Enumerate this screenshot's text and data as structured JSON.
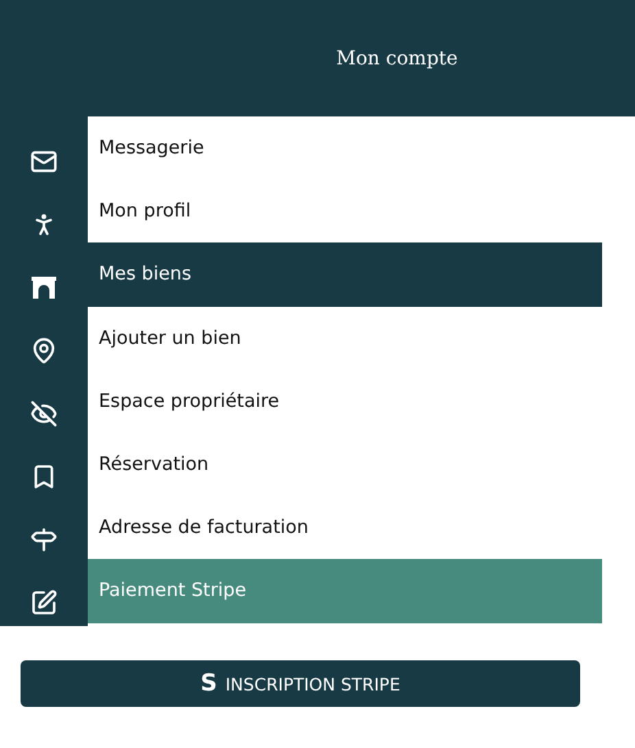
{
  "header": {
    "title": "Mon compte"
  },
  "menu": {
    "items": [
      {
        "label": "Messagerie",
        "selected": false,
        "highlighted": false
      },
      {
        "label": "Mon profil",
        "selected": false,
        "highlighted": false
      },
      {
        "label": "Mes biens",
        "selected": false,
        "highlighted": true
      },
      {
        "label": "Ajouter un bien",
        "selected": false,
        "highlighted": false
      },
      {
        "label": "Espace propriétaire",
        "selected": false,
        "highlighted": false
      },
      {
        "label": "Réservation",
        "selected": false,
        "highlighted": false
      },
      {
        "label": "Adresse de facturation",
        "selected": false,
        "highlighted": false
      },
      {
        "label": "Paiement Stripe",
        "selected": true,
        "highlighted": false
      }
    ]
  },
  "stripe_button": {
    "icon_text": "S",
    "label": "INSCRIPTION STRIPE"
  }
}
